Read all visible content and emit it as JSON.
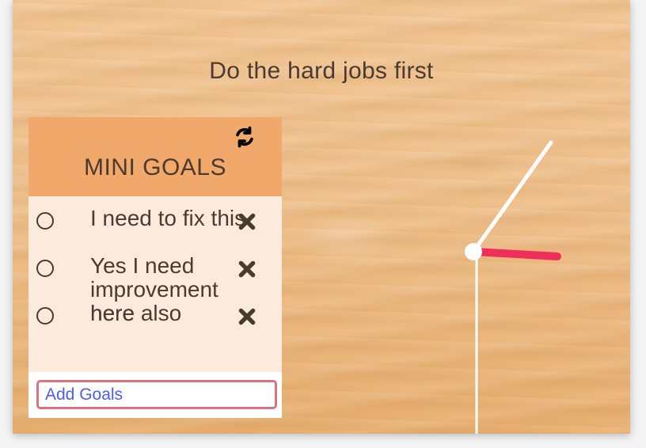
{
  "header": {
    "motto": "Do the hard jobs first"
  },
  "goals": {
    "title": "MINI GOALS",
    "items": [
      {
        "text": "I need to fix this"
      },
      {
        "text": "Yes I need improvement here"
      },
      {
        "text": "here also"
      }
    ],
    "input": {
      "placeholder": "Add Goals"
    }
  },
  "clock": {
    "hour_hand_color": "#ef2f5a",
    "minute_hand_color": "#ffffff",
    "second_hand_color": "#ffffff"
  },
  "icons": {
    "refresh": "refresh-icon",
    "delete": "close-icon",
    "checkbox": "circle-outline-icon"
  }
}
